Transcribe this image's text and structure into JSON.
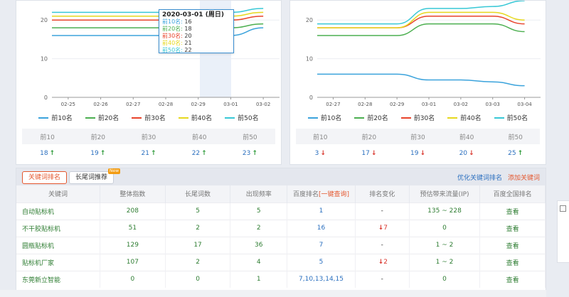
{
  "left_chart": {
    "y_ticks": [
      "0",
      "10",
      "20"
    ],
    "x_labels": [
      "02-25",
      "02-26",
      "02-27",
      "02-28",
      "02-29",
      "03-01",
      "03-02"
    ],
    "tooltip": {
      "title": "2020-03-01 (周日)",
      "rows": [
        {
          "label": "前10名",
          "value": "16"
        },
        {
          "label": "前20名",
          "value": "18"
        },
        {
          "label": "前30名",
          "value": "20"
        },
        {
          "label": "前40名",
          "value": "21"
        },
        {
          "label": "前50名",
          "value": "22"
        }
      ]
    },
    "legend": [
      "前10名",
      "前20名",
      "前30名",
      "前40名",
      "前50名"
    ],
    "summary": {
      "headers": [
        "前10",
        "前20",
        "前30",
        "前40",
        "前50"
      ],
      "values": [
        "18",
        "19",
        "21",
        "22",
        "23"
      ],
      "trends": [
        "up",
        "up",
        "up",
        "up",
        "up"
      ]
    }
  },
  "right_chart": {
    "y_ticks": [
      "0",
      "10",
      "20"
    ],
    "x_labels": [
      "02-27",
      "02-28",
      "02-29",
      "03-01",
      "03-02",
      "03-03",
      "03-04"
    ],
    "legend": [
      "前10名",
      "前20名",
      "前30名",
      "前40名",
      "前50名"
    ],
    "summary": {
      "headers": [
        "前10",
        "前20",
        "前30",
        "前40",
        "前50"
      ],
      "values": [
        "3",
        "17",
        "19",
        "20",
        "25"
      ],
      "trends": [
        "down",
        "down",
        "down",
        "down",
        "up"
      ]
    }
  },
  "chart_data": [
    {
      "type": "line",
      "x": [
        "02-25",
        "02-26",
        "02-27",
        "02-28",
        "02-29",
        "03-01",
        "03-02"
      ],
      "ylim": [
        0,
        25
      ],
      "y_ticks": [
        0,
        10,
        20
      ],
      "series": [
        {
          "name": "前10名",
          "color": "#3ba3dc",
          "values": [
            16,
            16,
            16,
            16,
            16,
            16,
            18
          ]
        },
        {
          "name": "前20名",
          "color": "#4caf50",
          "values": [
            18,
            18,
            18,
            18,
            18,
            18,
            19
          ]
        },
        {
          "name": "前30名",
          "color": "#e8432b",
          "values": [
            20,
            20,
            20,
            20,
            20,
            20,
            21
          ]
        },
        {
          "name": "前40名",
          "color": "#e6d81e",
          "values": [
            21,
            21,
            21,
            21,
            21,
            21,
            22
          ]
        },
        {
          "name": "前50名",
          "color": "#38c8d6",
          "values": [
            22,
            22,
            22,
            22,
            22,
            22,
            23
          ]
        }
      ]
    },
    {
      "type": "line",
      "x": [
        "02-27",
        "02-28",
        "02-29",
        "03-01",
        "03-02",
        "03-03",
        "03-04"
      ],
      "ylim": [
        0,
        25
      ],
      "y_ticks": [
        0,
        10,
        20
      ],
      "series": [
        {
          "name": "前10名",
          "color": "#3ba3dc",
          "values": [
            6,
            6,
            6,
            4.5,
            4.5,
            4,
            3
          ]
        },
        {
          "name": "前20名",
          "color": "#4caf50",
          "values": [
            16,
            16,
            16,
            19,
            19,
            19,
            17
          ]
        },
        {
          "name": "前30名",
          "color": "#e8432b",
          "values": [
            18,
            18,
            18,
            21,
            21,
            21,
            19
          ]
        },
        {
          "name": "前40名",
          "color": "#e6d81e",
          "values": [
            18,
            18,
            18,
            22,
            22,
            22,
            20
          ]
        },
        {
          "name": "前50名",
          "color": "#38c8d6",
          "values": [
            19,
            19,
            19,
            23,
            23,
            23.5,
            25
          ]
        }
      ]
    }
  ],
  "keyword_panel": {
    "tab_active": "关键词排名",
    "tab_other": "长尾词推荐",
    "badge": "New",
    "link_optimize": "优化关键词排名",
    "link_add": "添加关键词",
    "columns": [
      "关键词",
      "整体指数",
      "长尾词数",
      "出现频率",
      "百度排名",
      "排名变化",
      "预估带来流量(IP)",
      "百度全国排名"
    ],
    "baidu_rank_suffix": "[一键查询]",
    "rows": [
      {
        "keyword": "自动贴标机",
        "index": "208",
        "longtail": "5",
        "freq": "5",
        "rank": "1",
        "change": "-",
        "change_dir": "",
        "traffic": "135 ~ 228",
        "action": "查看"
      },
      {
        "keyword": "不干胶贴标机",
        "index": "51",
        "longtail": "2",
        "freq": "2",
        "rank": "16",
        "change": "7",
        "change_dir": "down",
        "traffic": "0",
        "action": "查看"
      },
      {
        "keyword": "圆瓶贴标机",
        "index": "129",
        "longtail": "17",
        "freq": "36",
        "rank": "7",
        "change": "-",
        "change_dir": "",
        "traffic": "1 ~ 2",
        "action": "查看"
      },
      {
        "keyword": "贴标机厂家",
        "index": "107",
        "longtail": "2",
        "freq": "4",
        "rank": "5",
        "change": "2",
        "change_dir": "down",
        "traffic": "1 ~ 2",
        "action": "查看"
      },
      {
        "keyword": "东莞新立智能",
        "index": "0",
        "longtail": "0",
        "freq": "1",
        "rank": "7,10,13,14,15",
        "change": "-",
        "change_dir": "",
        "traffic": "0",
        "action": "查看"
      }
    ]
  }
}
